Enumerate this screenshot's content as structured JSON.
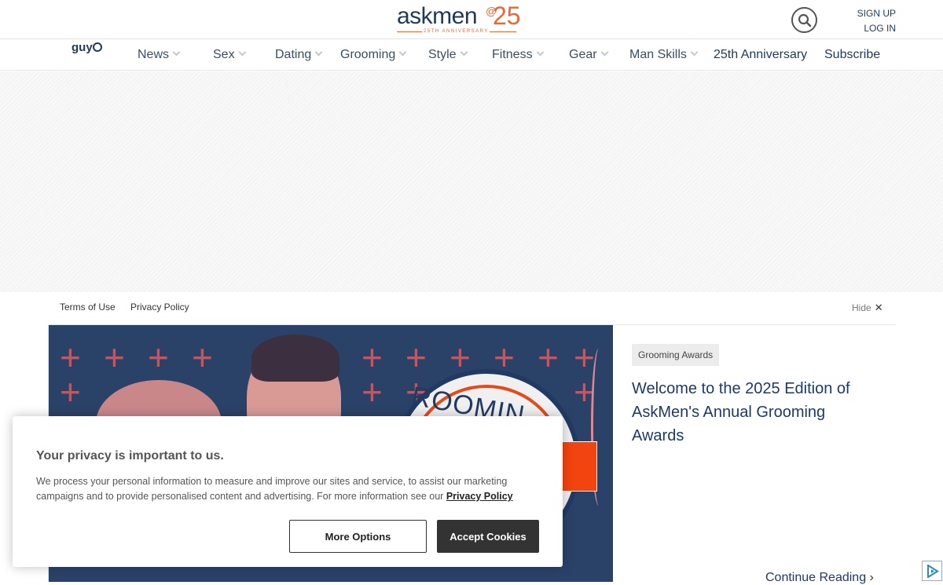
{
  "header": {
    "logo": {
      "word": "askmen",
      "at": "@",
      "number": "25",
      "tagline": "25TH ANNIVERSARY"
    },
    "search_icon": "search-icon",
    "sign_up": "SIGN UP",
    "log_in": "LOG IN"
  },
  "nav": {
    "guy_logo": "guy",
    "items": [
      {
        "label": "News"
      },
      {
        "label": "Sex"
      },
      {
        "label": "Dating"
      },
      {
        "label": "Grooming"
      },
      {
        "label": "Style"
      },
      {
        "label": "Fitness"
      },
      {
        "label": "Gear"
      },
      {
        "label": "Man Skills"
      },
      {
        "label": "25th Anniversary"
      },
      {
        "label": "Subscribe"
      }
    ]
  },
  "legal": {
    "terms": "Terms of Use",
    "privacy": "Privacy Policy",
    "hide": "Hide"
  },
  "feature": {
    "tag": "Grooming Awards",
    "headline": "Welcome to the 2025 Edition of AskMen's Annual Grooming Awards",
    "badge_text": "ROOMIN",
    "continue": "Continue Reading"
  },
  "cookie": {
    "title": "Your privacy is important to us.",
    "body": "We process your personal information to measure and improve our sites and service, to assist our marketing campaigns and to provide personalised content and advertising. For more information see our",
    "policy_link": "Privacy Policy",
    "more_options": "More Options",
    "accept": "Accept Cookies"
  },
  "colors": {
    "brand_navy": "#1d3a5b",
    "brand_orange": "#e6693a"
  }
}
